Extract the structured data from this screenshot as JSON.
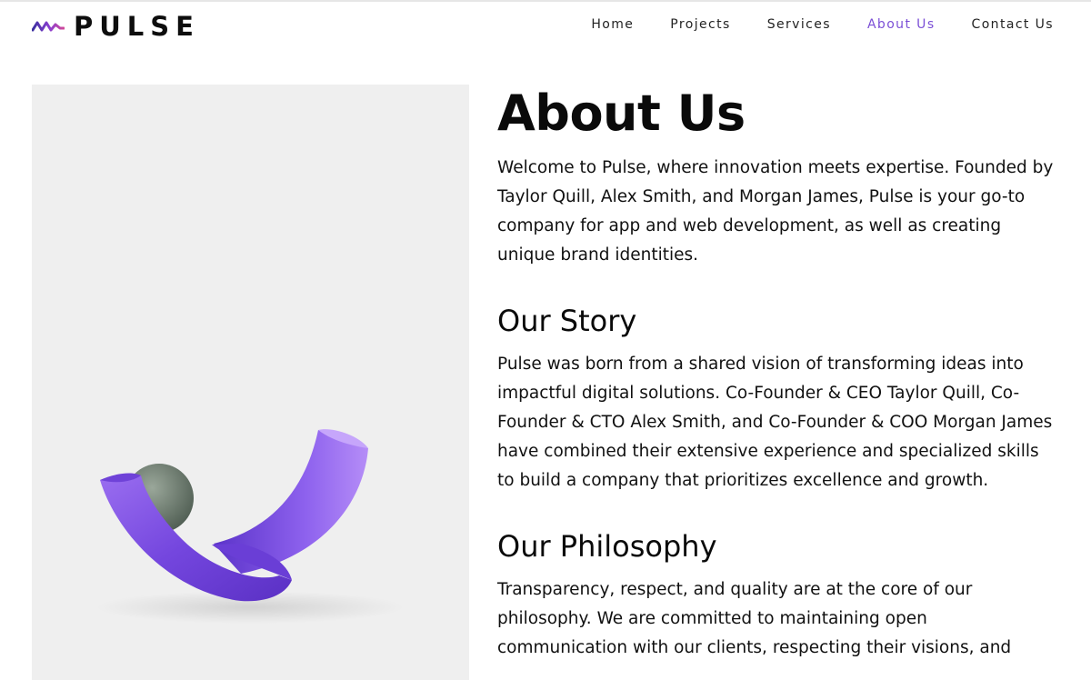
{
  "header": {
    "logo_text": "PULSE",
    "logo_icon": "pulse-wave-icon",
    "nav": [
      {
        "label": "Home"
      },
      {
        "label": "Projects"
      },
      {
        "label": "Services"
      },
      {
        "label": "About Us",
        "active": true
      },
      {
        "label": "Contact Us"
      }
    ]
  },
  "hero_image": {
    "subject": "abstract-3d-purple-tube-shapes"
  },
  "main": {
    "title": "About Us",
    "intro": "Welcome to Pulse, where innovation meets expertise. Founded by Taylor Quill, Alex Smith, and Morgan James, Pulse is your go-to company for app and web development, as well as creating unique brand identities.",
    "story": {
      "heading": "Our Story",
      "text": "Pulse was born from a shared vision of transforming ideas into impactful digital solutions. Co-Founder & CEO Taylor Quill, Co-Founder & CTO Alex Smith, and Co-Founder & COO Morgan James have combined their extensive experience and specialized skills to build a company that prioritizes excellence and growth."
    },
    "philosophy": {
      "heading": "Our Philosophy",
      "text": "Transparency, respect, and quality are at the core of our philosophy. We are committed to maintaining open communication with our clients, respecting their visions, and"
    }
  },
  "colors": {
    "accent": "#7b4fd6",
    "logo_gradient_start": "#3b2fa0",
    "logo_gradient_end": "#d04a9a",
    "panel_bg": "#efefef",
    "text": "#111111"
  }
}
